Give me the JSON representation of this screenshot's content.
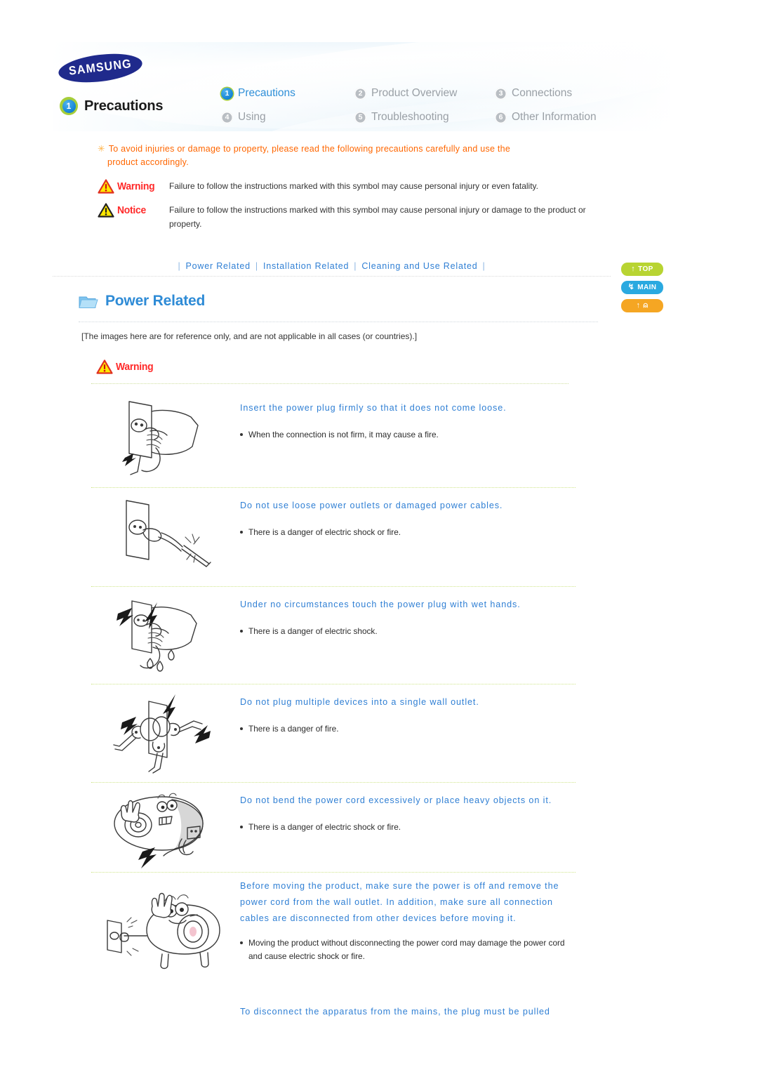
{
  "header": {
    "brand": "SAMSUNG",
    "page_badge_number": "1",
    "page_title": "Precautions",
    "nav": [
      {
        "num": "1",
        "label": "Precautions",
        "active": true
      },
      {
        "num": "2",
        "label": "Product Overview",
        "active": false
      },
      {
        "num": "3",
        "label": "Connections",
        "active": false
      },
      {
        "num": "4",
        "label": "Using",
        "active": false
      },
      {
        "num": "5",
        "label": "Troubleshooting",
        "active": false
      },
      {
        "num": "6",
        "label": "Other Information",
        "active": false
      }
    ]
  },
  "intro": {
    "asterisk": "✳",
    "note_line1": "To avoid injuries or damage to property, please read the following precautions carefully and use the",
    "note_line2": "product accordingly.",
    "legend": [
      {
        "tag": "Warning",
        "tag_color": "#ff2a2a",
        "triangle_stroke": "#e03020",
        "triangle_fill": "#ffe800",
        "text": "Failure to follow the instructions marked with this symbol may cause personal injury or even fatality."
      },
      {
        "tag": "Notice",
        "tag_color": "#ff2a2a",
        "triangle_stroke": "#222222",
        "triangle_fill": "#ffe800",
        "text": "Failure to follow the instructions marked with this symbol may cause personal injury or damage to the product or property."
      }
    ]
  },
  "section_nav": {
    "pipe": "|",
    "links": [
      "Power Related",
      "Installation Related",
      "Cleaning and Use Related"
    ]
  },
  "side_buttons": [
    {
      "label": "TOP",
      "icon": "up-arrow-icon",
      "color": "#b8d432"
    },
    {
      "label": "MAIN",
      "icon": "return-arrow-icon",
      "color": "#2aa9e0"
    },
    {
      "label": "",
      "icon": "home-icon",
      "color": "#f5a623"
    }
  ],
  "section": {
    "title": "Power Related",
    "reference_note": "[The images here are for reference only, and are not applicable in all cases (or countries).]",
    "warning_label": "Warning"
  },
  "items": [
    {
      "figure": "wall-outlet-hand-plug-illustration",
      "title": "Insert the power plug firmly so that it does not come loose.",
      "bullets": [
        "When the connection is not firm, it may cause a fire."
      ]
    },
    {
      "figure": "damaged-power-cable-illustration",
      "title": "Do not use loose power outlets or damaged power cables.",
      "bullets": [
        "There is a danger of electric shock or fire."
      ]
    },
    {
      "figure": "wet-hands-plug-illustration",
      "title": "Under no circumstances touch the power plug with wet hands.",
      "bullets": [
        "There is a danger of electric shock."
      ]
    },
    {
      "figure": "multiple-plugs-single-outlet-illustration",
      "title": "Do not plug multiple devices into a single wall outlet.",
      "bullets": [
        "There is a danger of fire."
      ]
    },
    {
      "figure": "bent-power-cord-character-illustration",
      "title": "Do not bend the power cord excessively or place heavy objects on it.",
      "bullets": [
        "There is a danger of electric shock or fire."
      ]
    },
    {
      "figure": "moving-product-unplug-character-illustration",
      "title": "Before moving the product, make sure the power is off and remove the power cord from the wall outlet. In addition, make sure all connection cables are disconnected from other devices before moving it.",
      "bullets": [
        "Moving the product without disconnecting the power cord may damage the power cord and cause electric shock or fire."
      ]
    }
  ],
  "tail_item": {
    "title": "To disconnect the apparatus from the mains, the plug must be pulled"
  }
}
